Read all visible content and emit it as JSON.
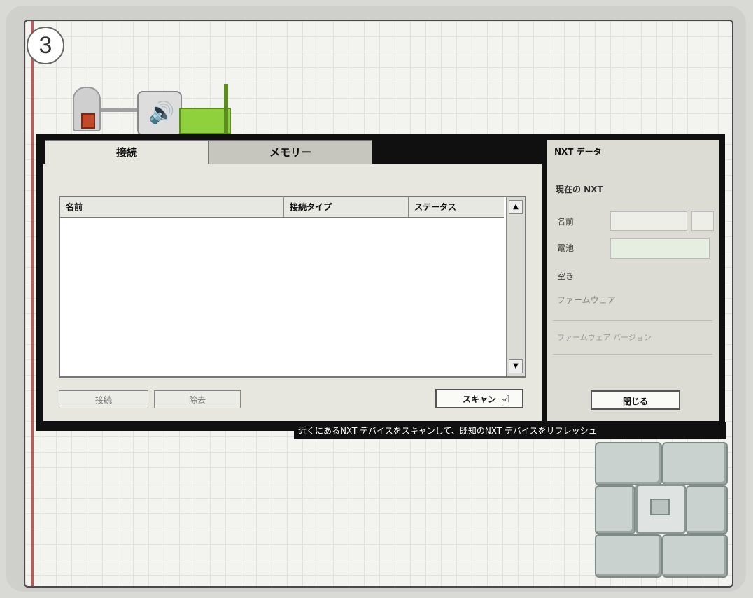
{
  "step": {
    "number": "3"
  },
  "tabs": [
    {
      "label": "接続",
      "active": true
    },
    {
      "label": "メモリー",
      "active": false
    }
  ],
  "table": {
    "columns": [
      "名前",
      "接続タイプ",
      "ステータス"
    ],
    "rows": []
  },
  "buttons": {
    "connect": "接続",
    "remove": "除去",
    "scan": "スキャン"
  },
  "side_panel": {
    "title": "NXT データ",
    "subtitle": "現在の NXT",
    "fields": {
      "name_label": "名前",
      "battery_label": "電池",
      "free_storage_label": "空き",
      "firmware_label": "ファームウェア"
    },
    "firmware_row": "ファームウェア バージョン",
    "close_button": "閉じる"
  },
  "tooltip": "近くにあるNXT デバイスをスキャンして、既知のNXT デバイスをリフレッシュ",
  "icons": [
    "speaker-icon",
    "touch-sensor-icon",
    "hand-cursor-icon",
    "controller-pad-icon"
  ]
}
